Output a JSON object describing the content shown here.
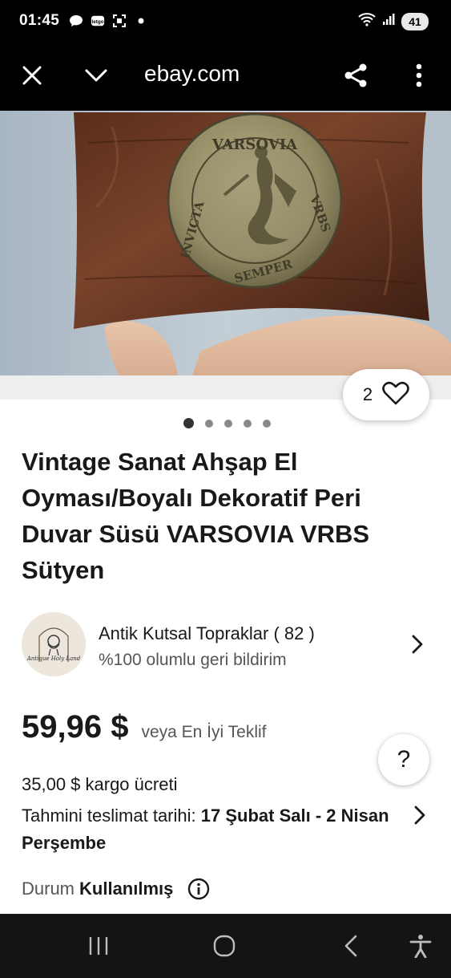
{
  "status_bar": {
    "time": "01:45",
    "battery": "41",
    "icons": [
      "chat-bubble-icon",
      "letgo-icon",
      "screenshot-icon",
      "dot-icon",
      "wifi-icon",
      "signal-icon"
    ]
  },
  "browser": {
    "url": "ebay.com",
    "icons": [
      "close-icon",
      "chevron-down-icon",
      "share-icon",
      "more-vert-icon"
    ]
  },
  "gallery": {
    "watch_count": "2",
    "total_images": 5,
    "active_index": 0,
    "medallion_text": [
      "VARSOVIA",
      "VRBS",
      "SEMPER",
      "INVICTA"
    ]
  },
  "product": {
    "title": "Vintage Sanat Ahşap El Oyması/Boyalı Dekoratif Peri Duvar Süsü VARSOVIA VRBS Sütyen"
  },
  "seller": {
    "name": "Antik Kutsal Topraklar ( 82 )",
    "feedback": "%100 olumlu geri bildirim",
    "avatar_text": "Antique Holy Land"
  },
  "pricing": {
    "price": "59,96 $",
    "or_best_offer": "veya En İyi Teklif"
  },
  "shipping": {
    "cost": "35,00 $ kargo ücreti",
    "delivery_label": "Tahmini teslimat tarihi:",
    "delivery_dates": "17 Şubat Salı - 2 Nisan Perşembe"
  },
  "condition": {
    "label": "Durum",
    "value": "Kullanılmış"
  },
  "help": {
    "label": "?"
  },
  "colors": {
    "text_primary": "#191919",
    "text_secondary": "#555555",
    "system_bar": "#000000",
    "nav_bar": "#141414"
  }
}
